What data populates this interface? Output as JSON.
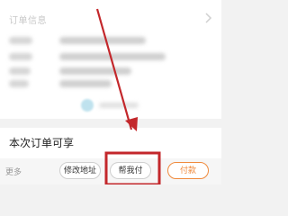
{
  "order": {
    "title": "订单信息",
    "blurred_rows": 5
  },
  "notice": {
    "text": "本次订单可享"
  },
  "actions": {
    "more_label": "更多",
    "modify_address_label": "修改地址",
    "help_pay_label": "帮我付",
    "pay_label": "付款"
  },
  "colors": {
    "annotation_red": "#c3272b",
    "pay_orange": "#f08a3c"
  }
}
